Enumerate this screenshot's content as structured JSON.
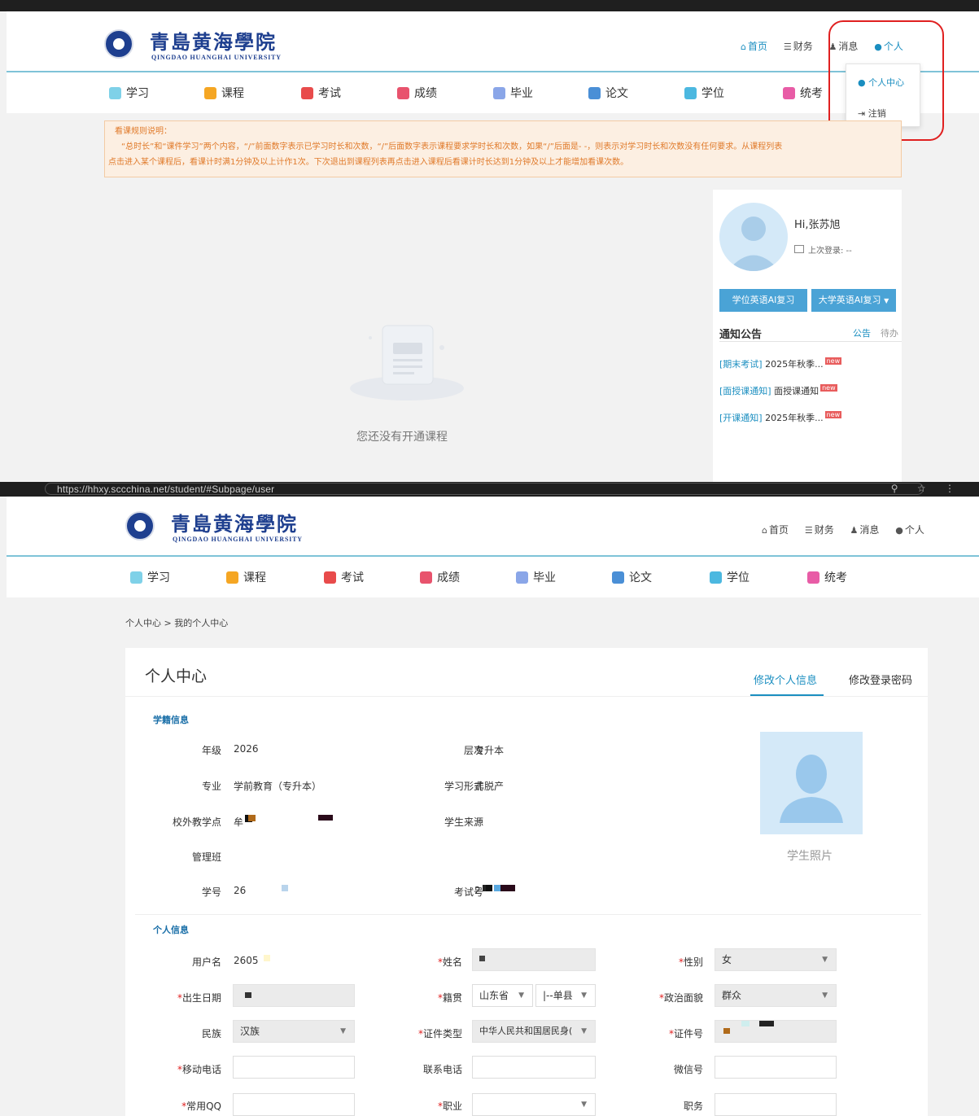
{
  "browser": {
    "url_bottom": "https://hhxy.sccchina.net/student/#Subpage/user"
  },
  "school": {
    "name_cn": "青島黄海學院",
    "name_en": "QINGDAO HUANGHAI UNIVERSITY"
  },
  "top_nav": {
    "home": "首页",
    "finance": "财务",
    "messages": "消息",
    "personal": "个人"
  },
  "main_nav": [
    {
      "label": "学习",
      "color": "#7fd1e8"
    },
    {
      "label": "课程",
      "color": "#f5a623"
    },
    {
      "label": "考试",
      "color": "#e84b4b"
    },
    {
      "label": "成绩",
      "color": "#e8536d"
    },
    {
      "label": "毕业",
      "color": "#8aa6e8"
    },
    {
      "label": "论文",
      "color": "#4a8fd6"
    },
    {
      "label": "学位",
      "color": "#4cb8e0"
    },
    {
      "label": "统考",
      "color": "#e85ca6"
    }
  ],
  "dropdown": {
    "center": "个人中心",
    "logout": "注销"
  },
  "notice": {
    "title": "看课规则说明：",
    "line1": "“总时长”和“课件学习”两个内容，“/”前面数字表示已学习时长和次数，“/”后面数字表示课程要求学时长和次数，如果“/”后面是- -，则表示对学习时长和次数没有任何要求。从课程列表",
    "line2": "点击进入某个课程后，看课计时满1分钟及以上计作1次。下次退出到课程列表再点击进入课程后看课计时长达到1分钟及以上才能增加看课次数。"
  },
  "profile_card": {
    "greeting": "Hi,张苏旭",
    "last_login": "上次登录: --",
    "btn_degree_english": "学位英语AI复习",
    "btn_college_english": "大学英语AI复习",
    "notice_heading": "通知公告",
    "tab_notice": "公告",
    "tab_todo": "待办",
    "items": [
      {
        "tag": "[期末考试]",
        "text": "2025年秋季...",
        "badge": "new"
      },
      {
        "tag": "[面授课通知]",
        "text": "面授课通知",
        "badge": "new"
      },
      {
        "tag": "[开课通知]",
        "text": "2025年秋季...",
        "badge": "new"
      }
    ]
  },
  "empty_state": "您还没有开通课程",
  "breadcrumb": "个人中心 > 我的个人中心",
  "personal_center": {
    "title": "个人中心",
    "tab_edit_info": "修改个人信息",
    "tab_change_password": "修改登录密码",
    "enrollment_section": "学籍信息",
    "grade_label": "年级",
    "grade_value": "2026",
    "level_label": "层次",
    "level_value": "专升本",
    "major_label": "专业",
    "major_value": "学前教育（专升本）",
    "study_form_label": "学习形式",
    "study_form_value": "非脱产",
    "study_center_label": "校外教学点",
    "study_center_value": "牟",
    "source_label": "学生来源",
    "source_value": "--",
    "class_label": "管理班",
    "student_no_label": "学号",
    "student_no_value": "26",
    "exam_no_label": "考试号",
    "exam_no_value": "2",
    "photo_label": "学生照片",
    "personal_section": "个人信息",
    "username_label": "用户名",
    "username_value": "2605",
    "name_label": "姓名",
    "gender_label": "性别",
    "gender_value": "女",
    "birth_label": "出生日期",
    "native_label": "籍贯",
    "province_value": "山东省",
    "county_value": "|--单县",
    "political_label": "政治面貌",
    "political_value": "群众",
    "ethnicity_label": "民族",
    "ethnicity_value": "汉族",
    "id_type_label": "证件类型",
    "id_type_value": "中华人民共和国居民身(",
    "id_no_label": "证件号",
    "mobile_label": "移动电话",
    "contact_label": "联系电话",
    "wechat_label": "微信号",
    "qq_label": "常用QQ",
    "job_label": "职业",
    "position_label": "职务",
    "required_mark": "*"
  }
}
